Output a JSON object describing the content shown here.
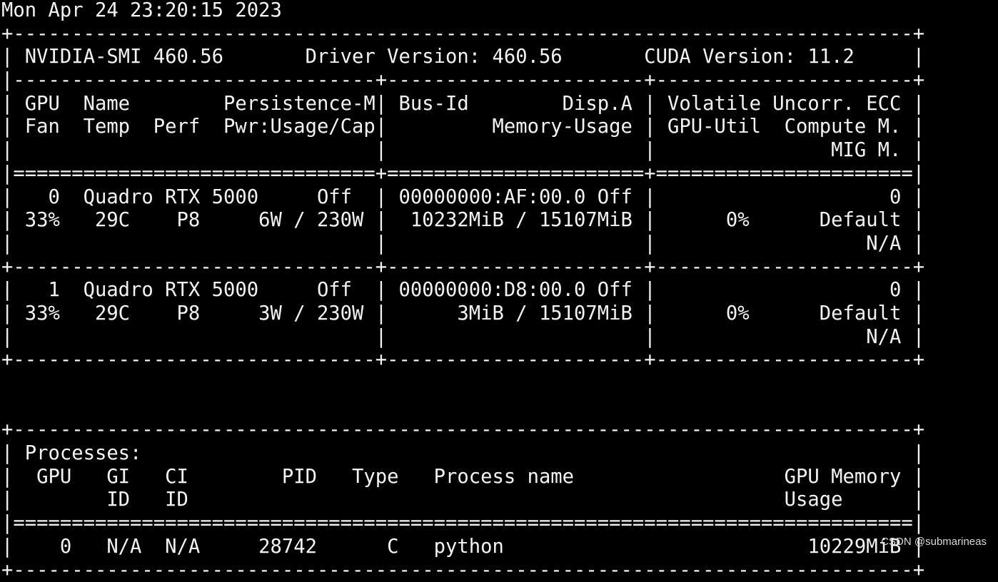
{
  "terminal": {
    "lines": [
      "Mon Apr 24 23:20:15 2023",
      "+-----------------------------------------------------------------------------+",
      "| NVIDIA-SMI 460.56       Driver Version: 460.56       CUDA Version: 11.2     |",
      "|-------------------------------+----------------------+----------------------+",
      "| GPU  Name        Persistence-M| Bus-Id        Disp.A | Volatile Uncorr. ECC |",
      "| Fan  Temp  Perf  Pwr:Usage/Cap|         Memory-Usage | GPU-Util  Compute M. |",
      "|                               |                      |               MIG M. |",
      "|===============================+======================+======================|",
      "|   0  Quadro RTX 5000     Off  | 00000000:AF:00.0 Off |                    0 |",
      "| 33%   29C    P8     6W / 230W |  10232MiB / 15107MiB |      0%      Default |",
      "|                               |                      |                  N/A |",
      "+-------------------------------+----------------------+----------------------+",
      "|   1  Quadro RTX 5000     Off  | 00000000:D8:00.0 Off |                    0 |",
      "| 33%   29C    P8     3W / 230W |      3MiB / 15107MiB |      0%      Default |",
      "|                               |                      |                  N/A |",
      "+-------------------------------+----------------------+----------------------+",
      "",
      "",
      "+-----------------------------------------------------------------------------+",
      "| Processes:                                                                  |",
      "|  GPU   GI   CI        PID   Type   Process name                  GPU Memory |",
      "|        ID   ID                                                   Usage      |",
      "|=============================================================================|",
      "|    0   N/A  N/A     28742      C   python                          10229MiB |",
      "+-----------------------------------------------------------------------------+"
    ]
  },
  "watermark": "CSDN @submarineas"
}
